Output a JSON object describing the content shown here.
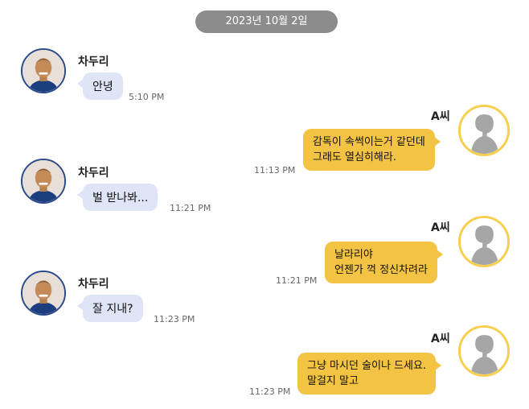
{
  "date_label": "2023년 10월 2일",
  "colors": {
    "date_pill": "#8c8c8c",
    "incoming_bubble": "#dfe4f6",
    "outgoing_bubble": "#f3c343",
    "avatar_a_border": "#f6d04d",
    "avatar_border": "#2a4a8a"
  },
  "icons": {
    "sender_avatar": "person-photo-icon",
    "me_avatar": "silhouette-avatar-icon"
  },
  "messages": [
    {
      "sender": "차두리",
      "lines": [
        "안녕"
      ],
      "time": "5:10 PM"
    },
    {
      "sender": "A씨",
      "lines": [
        "감독이 속썩이는거 같던데",
        "그래도 열심히해라."
      ],
      "time": "11:13 PM"
    },
    {
      "sender": "차두리",
      "lines": [
        "벌 받나봐..."
      ],
      "time": "11:21 PM"
    },
    {
      "sender": "A씨",
      "lines": [
        "날라리야",
        "언젠가 꺽 정신차려라"
      ],
      "time": "11:21 PM"
    },
    {
      "sender": "차두리",
      "lines": [
        "잘 지내?"
      ],
      "time": "11:23 PM"
    },
    {
      "sender": "A씨",
      "lines": [
        "그냥 마시던 술이나 드세요.",
        "말걸지 말고"
      ],
      "time": "11:23 PM"
    }
  ]
}
